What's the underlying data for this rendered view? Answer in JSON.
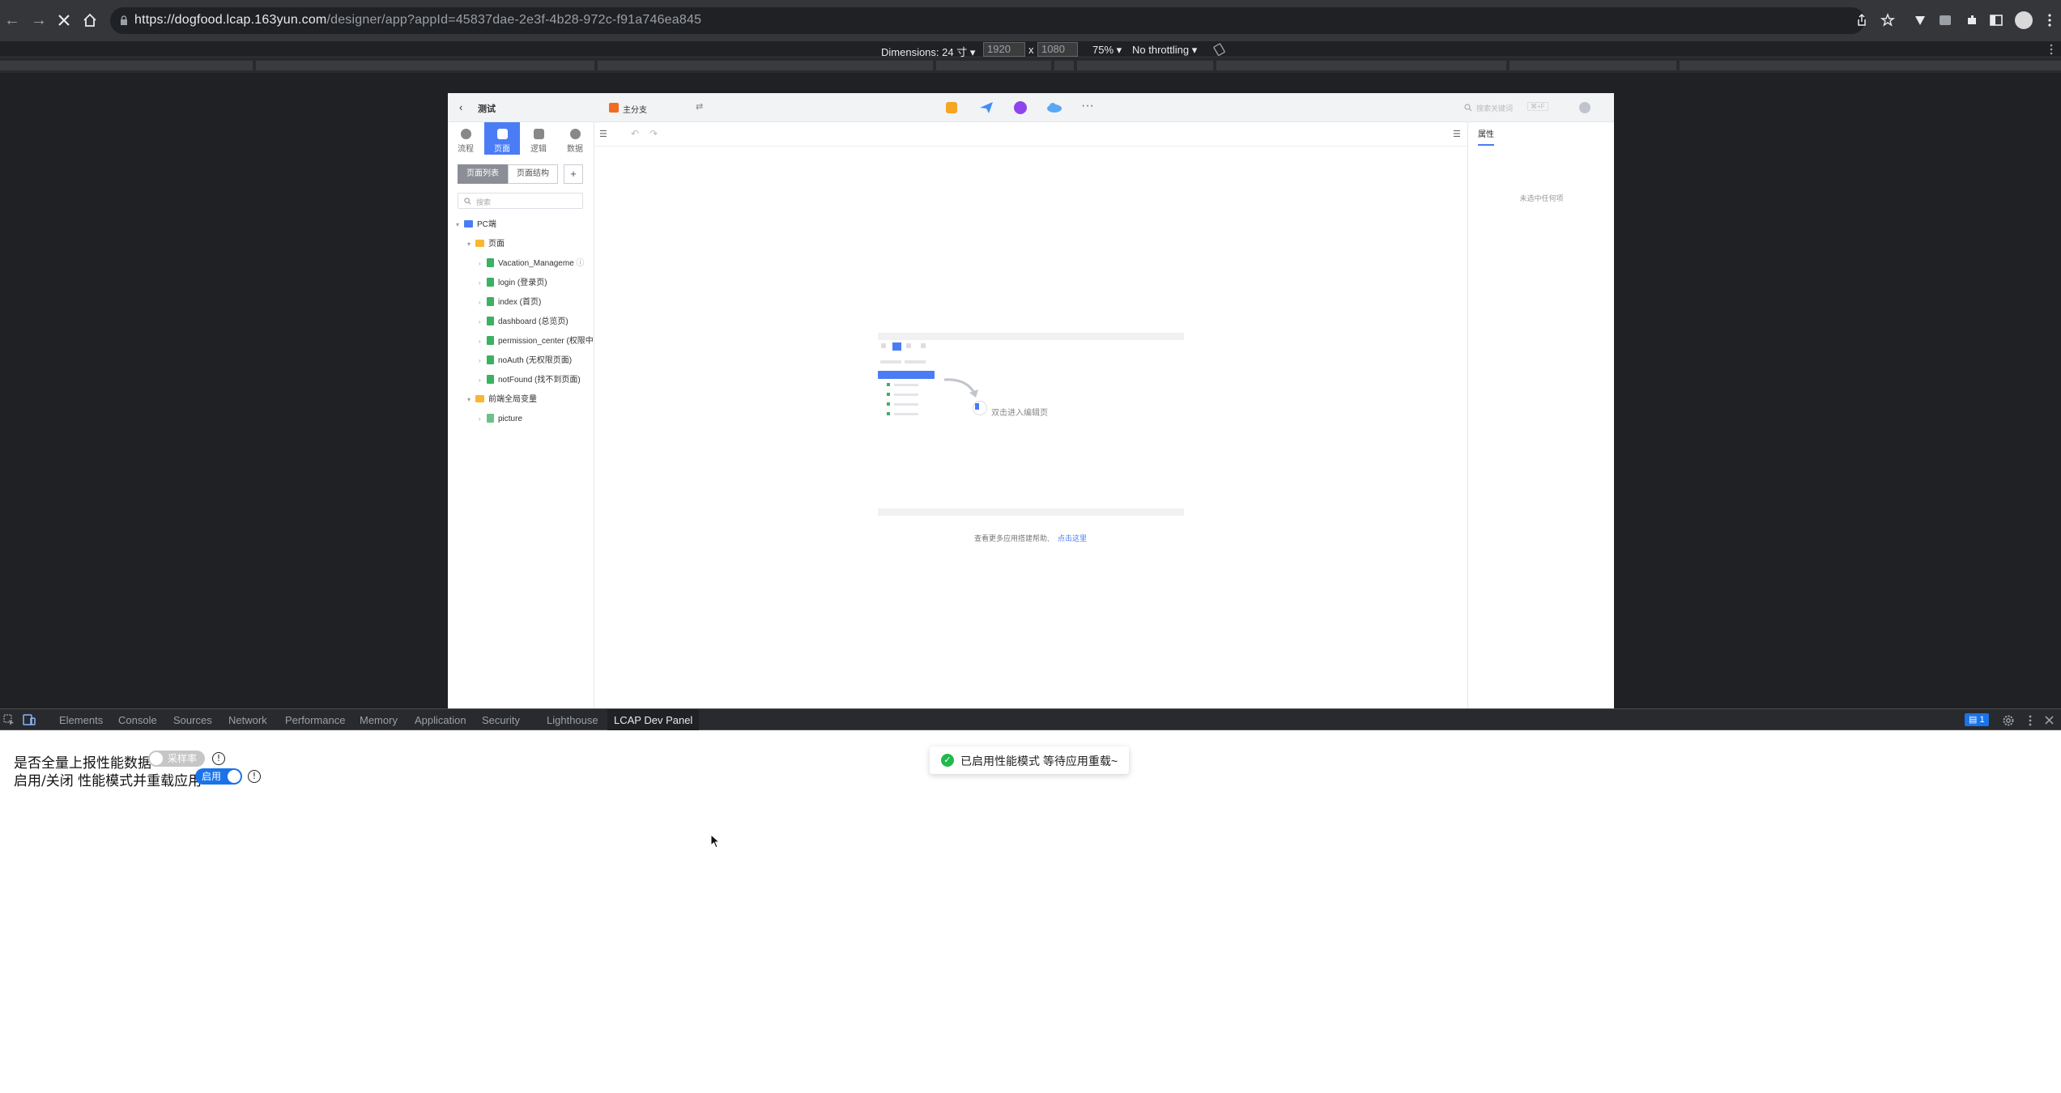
{
  "browser": {
    "url_host": "https://dogfood.lcap.163yun.com",
    "url_path": "/designer/app?appId=45837dae-2e3f-4b28-972c-f91a746ea845"
  },
  "device_toolbar": {
    "dimensions_label": "Dimensions: 24 寸",
    "width": "1920",
    "times": "x",
    "height": "1080",
    "zoom": "75%",
    "throttling": "No throttling"
  },
  "ide": {
    "back": "‹",
    "project": "测试",
    "branch": "主分支",
    "search_placeholder": "搜索关键词",
    "search_shortcut": "⌘+F",
    "nav": [
      {
        "label": "流程"
      },
      {
        "label": "页面"
      },
      {
        "label": "逻辑"
      },
      {
        "label": "数据"
      }
    ],
    "seg_page_list": "页面列表",
    "seg_page_structure": "页面结构",
    "add": "+",
    "filter_placeholder": "搜索",
    "tree": {
      "pc": "PC端",
      "pages_folder": "页面",
      "pages": [
        "Vacation_Manageme",
        "login (登录页)",
        "index (首页)",
        "dashboard (总览页)",
        "permission_center (权限中",
        "noAuth (无权限页面)",
        "notFound (找不到页面)"
      ],
      "globals_folder": "前端全局变量",
      "globals": [
        "picture"
      ]
    },
    "canvas_hint": "双击进入编辑页",
    "help_text": "查看更多应用搭建帮助,",
    "help_link": "点击这里",
    "props_tab": "属性",
    "props_empty": "未选中任何项"
  },
  "devtools": {
    "tabs": [
      "Elements",
      "Console",
      "Sources",
      "Network",
      "Performance",
      "Memory",
      "Application",
      "Security",
      "Lighthouse",
      "LCAP Dev Panel"
    ],
    "active_tab": "LCAP Dev Panel",
    "issues_count": "1"
  },
  "panel": {
    "row1_label": "是否全量上报性能数据",
    "row1_toggle": "采样率",
    "row2_label": "启用/关闭 性能模式并重载应用",
    "row2_toggle": "启用",
    "info": "!",
    "toast": "已启用性能模式 等待应用重载~",
    "toast_icon": "✓"
  },
  "colors": {
    "accent": "#4a7cf6",
    "toggle_on": "#1a73e8",
    "success": "#21b94e"
  }
}
